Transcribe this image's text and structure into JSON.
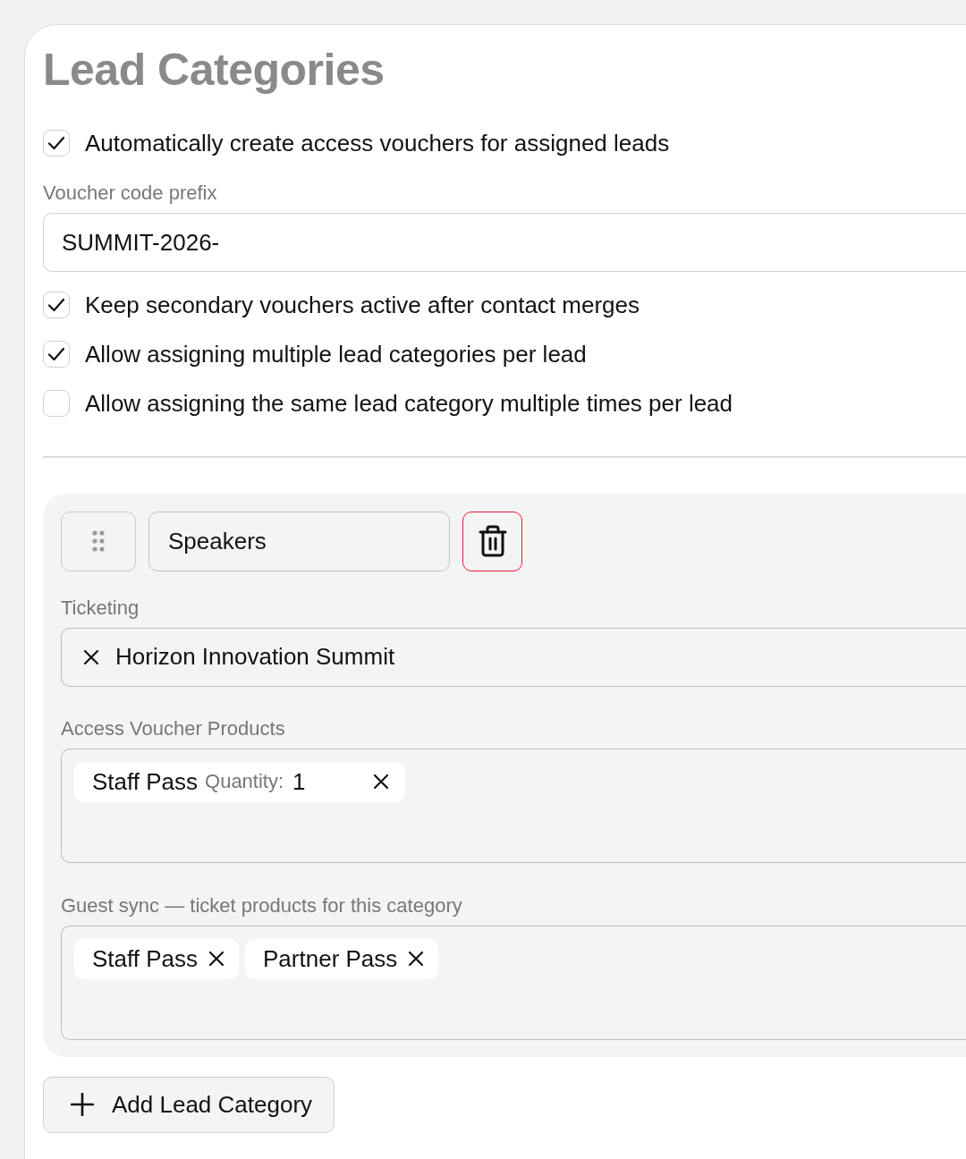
{
  "title": "Lead Categories",
  "options": [
    {
      "label": "Automatically create access vouchers for assigned leads",
      "checked": true
    }
  ],
  "voucher_prefix": {
    "label": "Voucher code prefix",
    "value": "SUMMIT-2026-"
  },
  "more_options": [
    {
      "label": "Keep secondary vouchers active after contact merges",
      "checked": true
    },
    {
      "label": "Allow assigning multiple lead categories per lead",
      "checked": true
    },
    {
      "label": "Allow assigning the same lead category multiple times per lead",
      "checked": false
    }
  ],
  "categories": [
    {
      "name": "Speakers",
      "ticketing": {
        "label": "Ticketing",
        "events": [
          "Horizon Innovation Summit"
        ]
      },
      "access_voucher_products": {
        "label": "Access Voucher Products",
        "items": [
          {
            "name": "Staff Pass",
            "quantity_label": "Quantity:",
            "quantity": "1"
          }
        ]
      },
      "guest_sync": {
        "label": "Guest sync — ticket products for this category",
        "items": [
          "Staff Pass",
          "Partner Pass"
        ]
      }
    }
  ],
  "add_button": "Add Lead Category"
}
